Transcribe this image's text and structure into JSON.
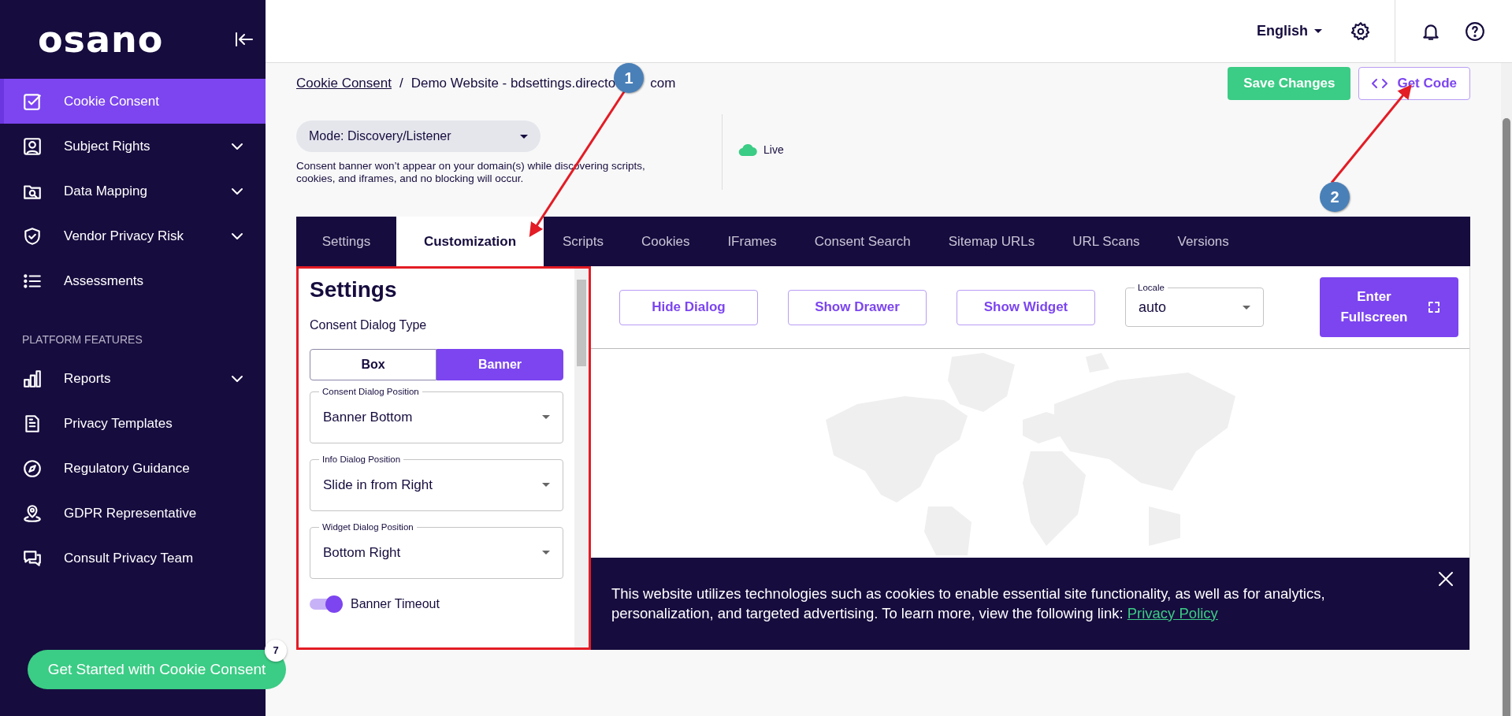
{
  "brand": {
    "logo": "osano"
  },
  "sidebar": {
    "items": [
      {
        "label": "Cookie Consent",
        "selected": true,
        "expandable": false
      },
      {
        "label": "Subject Rights",
        "selected": false,
        "expandable": true
      },
      {
        "label": "Data Mapping",
        "selected": false,
        "expandable": true
      },
      {
        "label": "Vendor Privacy Risk",
        "selected": false,
        "expandable": true
      },
      {
        "label": "Assessments",
        "selected": false,
        "expandable": false
      }
    ],
    "section_label": "PLATFORM FEATURES",
    "features": [
      {
        "label": "Reports",
        "selected": false,
        "expandable": true
      },
      {
        "label": "Privacy Templates",
        "selected": false,
        "expandable": false
      },
      {
        "label": "Regulatory Guidance",
        "selected": false,
        "expandable": false
      },
      {
        "label": "GDPR Representative",
        "selected": false,
        "expandable": false
      },
      {
        "label": "Consult Privacy Team",
        "selected": false,
        "expandable": false
      }
    ],
    "cta": {
      "label": "Get Started with Cookie Consent",
      "badge": "7"
    }
  },
  "header": {
    "language": "English"
  },
  "breadcrumb": {
    "link": "Cookie Consent",
    "separator": "/",
    "current_start": "Demo Website - bdsettings.directo",
    "current_end": "com"
  },
  "actions": {
    "save": "Save Changes",
    "get_code": "Get Code"
  },
  "mode": {
    "value": "Mode: Discovery/Listener",
    "note": "Consent banner won’t appear on your domain(s) while discovering scripts, cookies, and iframes, and no blocking will occur.",
    "status": "Live"
  },
  "tabs": [
    {
      "label": "Settings",
      "selected": false
    },
    {
      "label": "Customization",
      "selected": true
    },
    {
      "label": "Scripts",
      "selected": false
    },
    {
      "label": "Cookies",
      "selected": false
    },
    {
      "label": "IFrames",
      "selected": false
    },
    {
      "label": "Consent Search",
      "selected": false
    },
    {
      "label": "Sitemap URLs",
      "selected": false
    },
    {
      "label": "URL Scans",
      "selected": false
    },
    {
      "label": "Versions",
      "selected": false
    }
  ],
  "settings_panel": {
    "title": "Settings",
    "dialog_type_label": "Consent Dialog Type",
    "dialog_types": [
      {
        "label": "Box",
        "selected": false
      },
      {
        "label": "Banner",
        "selected": true
      }
    ],
    "selects": [
      {
        "label": "Consent Dialog Position",
        "value": "Banner Bottom"
      },
      {
        "label": "Info Dialog Position",
        "value": "Slide in from Right"
      },
      {
        "label": "Widget Dialog Position",
        "value": "Bottom Right"
      }
    ],
    "toggle": {
      "label": "Banner Timeout",
      "on": true
    }
  },
  "preview": {
    "buttons": [
      "Hide Dialog",
      "Show Drawer",
      "Show Widget"
    ],
    "locale": {
      "label": "Locale",
      "value": "auto"
    },
    "fullscreen": "Enter Fullscreen",
    "banner": {
      "text": "This website utilizes technologies such as cookies to enable essential site functionality, as well as for analytics, personalization, and targeted advertising. To learn more, view the following link: ",
      "link": "Privacy Policy"
    }
  },
  "annotations": [
    {
      "number": "1"
    },
    {
      "number": "2"
    }
  ]
}
